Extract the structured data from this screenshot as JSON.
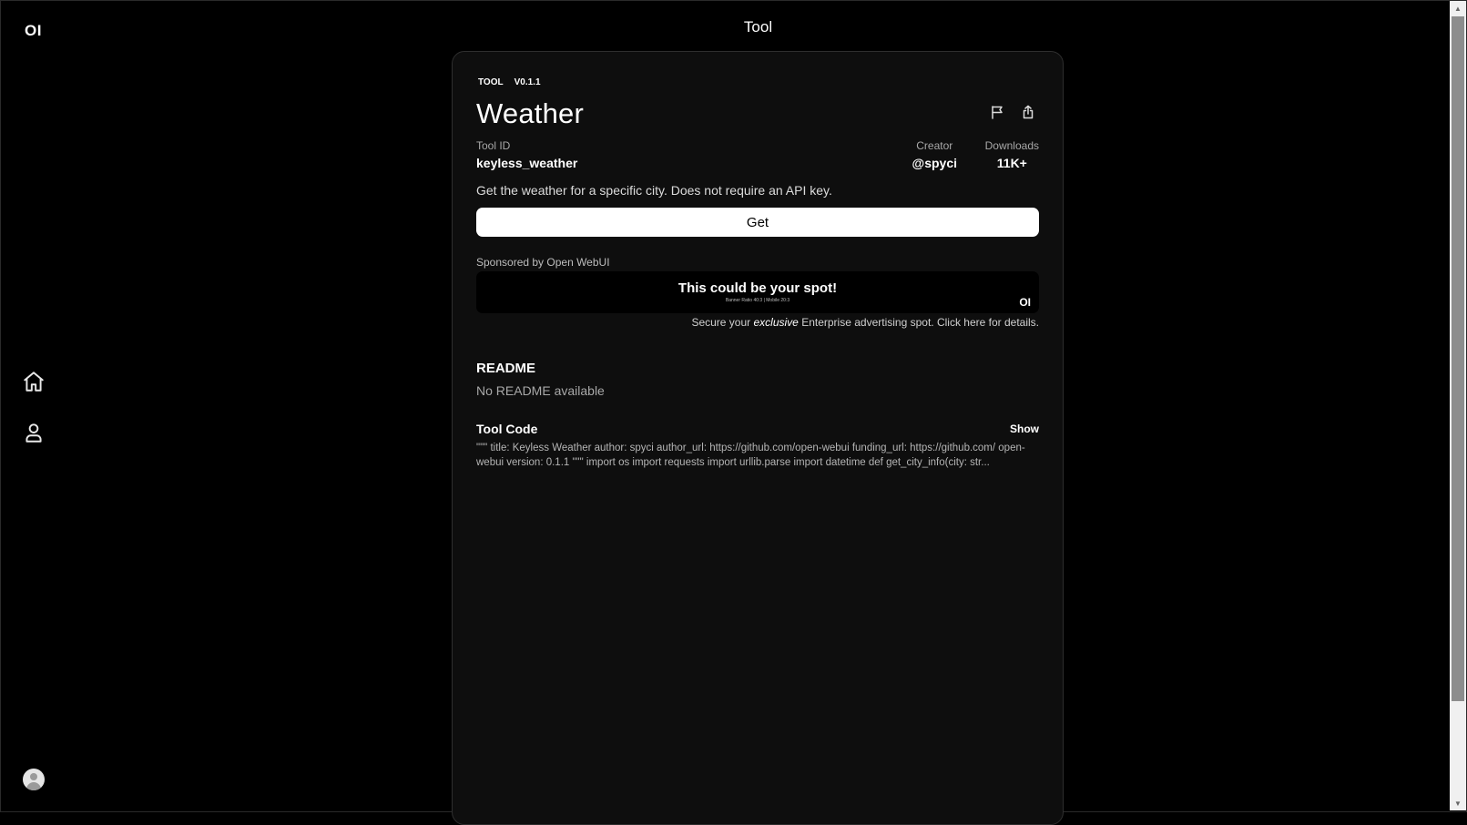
{
  "sidebar": {
    "logo": "OI",
    "icons": [
      "home-icon",
      "user-icon",
      "avatar"
    ]
  },
  "header": {
    "title": "Tool"
  },
  "tool": {
    "type_tag": "TOOL",
    "version_tag": "V0.1.1",
    "name": "Weather",
    "id_label": "Tool ID",
    "id_value": "keyless_weather",
    "creator_label": "Creator",
    "creator_value": "@spyci",
    "downloads_label": "Downloads",
    "downloads_value": "11K+",
    "description": "Get the weather for a specific city. Does not require an API key.",
    "get_label": "Get"
  },
  "sponsor": {
    "label": "Sponsored by Open WebUI",
    "banner_title": "This could be your spot!",
    "banner_subtitle": "Banner Ratio 40:3 | Mobile 20:3",
    "banner_logo": "OI",
    "secure_prefix": "Secure your",
    "secure_emphasis": "exclusive",
    "secure_suffix": "Enterprise advertising spot. Click here for details."
  },
  "readme": {
    "heading": "README",
    "body": "No README available"
  },
  "code": {
    "heading": "Tool Code",
    "show_label": "Show",
    "preview": "\"\"\" title: Keyless Weather author: spyci author_url: https://github.com/open-webui funding_url: https://github.com/ open-webui version: 0.1.1 \"\"\" import os import requests import urllib.parse import datetime def get_city_info(city: str..."
  },
  "colors": {
    "background": "#000000",
    "card": "#0e0e0e",
    "button": "#ffffff"
  }
}
